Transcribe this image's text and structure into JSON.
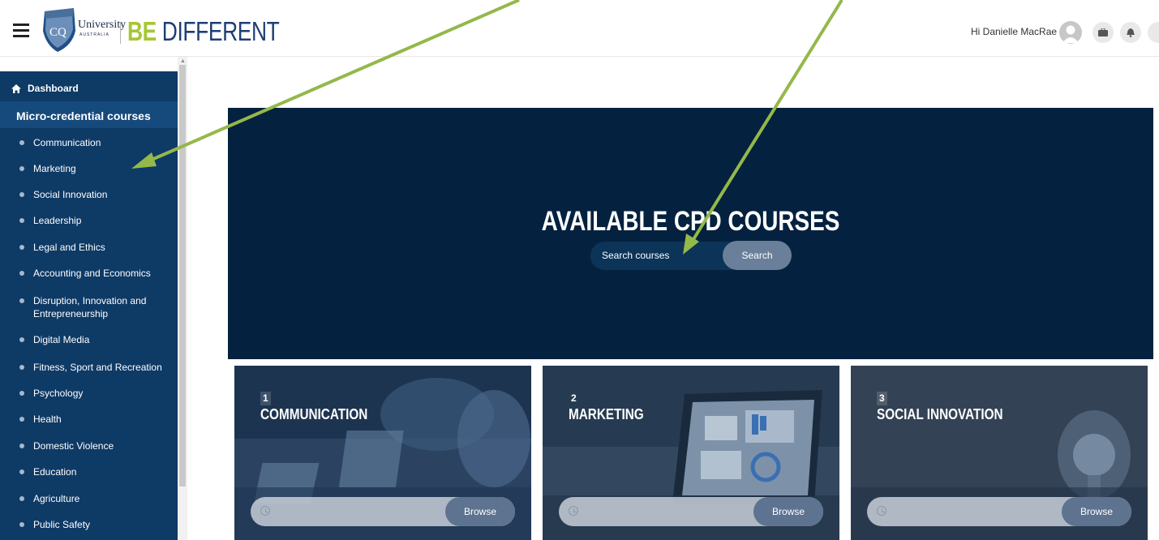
{
  "header": {
    "logo_initials": "CQ",
    "logo_name": "University",
    "logo_sub": "AUSTRALIA",
    "tagline_be": "BE",
    "tagline_rest": " DIFFERENT",
    "greeting": "Hi Danielle MacRae",
    "icons": [
      "user-avatar",
      "briefcase-icon",
      "bell-icon"
    ]
  },
  "sidebar": {
    "dashboard_label": "Dashboard",
    "section_title": "Micro-credential courses",
    "items": [
      {
        "label": "Communication"
      },
      {
        "label": "Marketing"
      },
      {
        "label": "Social Innovation"
      },
      {
        "label": "Leadership"
      },
      {
        "label": "Legal and Ethics"
      },
      {
        "label": "Accounting and Economics"
      },
      {
        "label": "Disruption, Innovation and Entrepreneurship",
        "line1": "Disruption, Innovation and",
        "line2": "Entrepreneurship"
      },
      {
        "label": "Digital Media"
      },
      {
        "label": "Fitness, Sport and Recreation"
      },
      {
        "label": "Psychology"
      },
      {
        "label": "Health"
      },
      {
        "label": "Domestic Violence"
      },
      {
        "label": "Education"
      },
      {
        "label": "Agriculture"
      },
      {
        "label": "Public Safety"
      }
    ]
  },
  "hero": {
    "title": "AVAILABLE CPD COURSES",
    "search_placeholder": "Search courses",
    "search_button": "Search"
  },
  "cards": [
    {
      "number": "1",
      "title": "COMMUNICATION",
      "button": "Browse"
    },
    {
      "number": "2",
      "title": "MARKETING",
      "button": "Browse"
    },
    {
      "number": "3",
      "title": "SOCIAL INNOVATION",
      "button": "Browse"
    }
  ],
  "colors": {
    "sidebar_bg": "#0e3a66",
    "hero_bg": "#04223f",
    "brand_green": "#a6c637",
    "brand_blue": "#1d3e75",
    "arrow": "#94b84a"
  }
}
